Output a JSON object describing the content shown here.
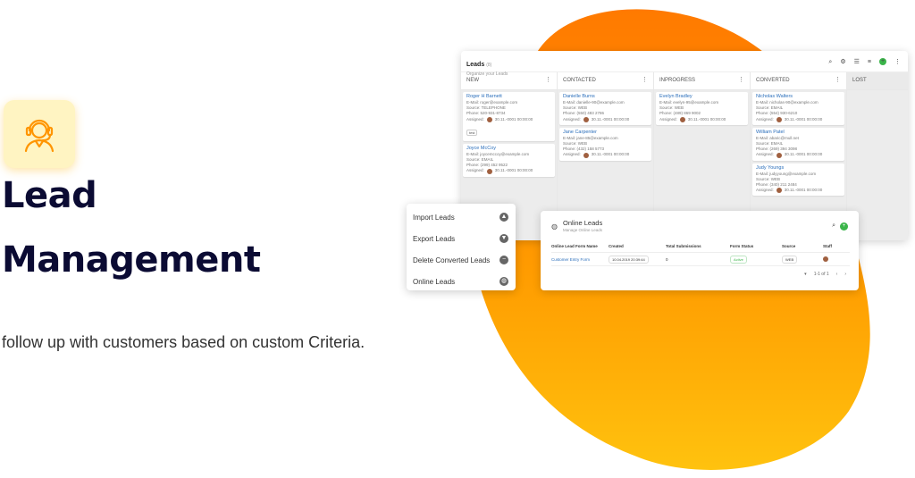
{
  "hero": {
    "icon": "support-agent-icon",
    "title_line1": "Lead",
    "title_line2": "Management",
    "subtitle": "follow up with customers  based on custom Criteria."
  },
  "colors": {
    "accent_orange": "#ff8a00",
    "blob_yellow": "#ffc20e",
    "brand_dark": "#0b0b33",
    "link_blue": "#2a6ebb",
    "add_green": "#3bb54a"
  },
  "leads": {
    "title": "Leads",
    "count": "(8)",
    "subtitle": "Organize your Leads",
    "columns": [
      {
        "label": "NEW",
        "cards": [
          {
            "name": "Roger H Barnett",
            "email": "E-Mail: roger@example.com",
            "source": "Source: TELEPHONE",
            "phone": "Phone: 520-931-8734",
            "assigned": "30.11.-0001 00:00:00",
            "tag": "test"
          },
          {
            "name": "Joyce McCoy",
            "email": "E-Mail: joycemccoy@example.com",
            "source": "Source: EMAIL",
            "phone": "Phone: (299) 452 9522",
            "assigned": "30.11.-0001 00:00:00",
            "tag": ""
          }
        ]
      },
      {
        "label": "CONTACTED",
        "cards": [
          {
            "name": "Danielle Burns",
            "email": "E-Mail: danielle-90@example.com",
            "source": "Source: WEB",
            "phone": "Phone: (550) 483 2786",
            "assigned": "30.11.-0001 00:00:00",
            "tag": ""
          },
          {
            "name": "Jane Carpenter",
            "email": "E-Mail: jane-85@example.com",
            "source": "Source: WEB",
            "phone": "Phone: (432) 158 5773",
            "assigned": "30.11.-0001 00:00:00",
            "tag": ""
          }
        ]
      },
      {
        "label": "INPROGRESS",
        "cards": [
          {
            "name": "Evelyn Bradley",
            "email": "E-Mail: evelyn-95@example.com",
            "source": "Source: WEB",
            "phone": "Phone: (489) 869 9002",
            "assigned": "30.11.-0001 00:00:00",
            "tag": ""
          }
        ]
      },
      {
        "label": "CONVERTED",
        "cards": [
          {
            "name": "Nicholas Walters",
            "email": "E-Mail: nicholas-90@example.com",
            "source": "Source: EMAIL",
            "phone": "Phone: (554) 930-6210",
            "assigned": "30.11.-0001 00:00:00",
            "tag": ""
          },
          {
            "name": "William Patel",
            "email": "E-Mail: abaric@mull.net",
            "source": "Source: EMAIL",
            "phone": "Phone: (269) 394 3098",
            "assigned": "30.11.-0001 00:00:00",
            "tag": ""
          },
          {
            "name": "Judy Youngs",
            "email": "E-Mail: judyyoung@example.com",
            "source": "Source: WEB",
            "phone": "Phone: (340) 211 2484",
            "assigned": "30.11.-0001 00:00:00",
            "tag": ""
          }
        ]
      },
      {
        "label": "LOST",
        "cards": []
      }
    ],
    "assigned_label": "Assigned:"
  },
  "menu": {
    "items": [
      {
        "label": "Import Leads",
        "icon": "cloud-upload-icon"
      },
      {
        "label": "Export Leads",
        "icon": "cloud-download-icon"
      },
      {
        "label": "Delete Converted Leads",
        "icon": "minus-circle-icon"
      },
      {
        "label": "Online Leads",
        "icon": "globe-icon"
      }
    ]
  },
  "online_leads": {
    "title": "Online Leads",
    "subtitle": "Manage Online Leads",
    "headers": [
      "Online Lead Form Name",
      "Created",
      "Total Submissions",
      "Form Status",
      "Source",
      "Staff"
    ],
    "rows": [
      {
        "name": "Customer Entry Form",
        "created": "10.04.2019 20:39:44",
        "submissions": "0",
        "status": "Active",
        "source": "WEB"
      }
    ],
    "pager": "1-1 of 1"
  }
}
